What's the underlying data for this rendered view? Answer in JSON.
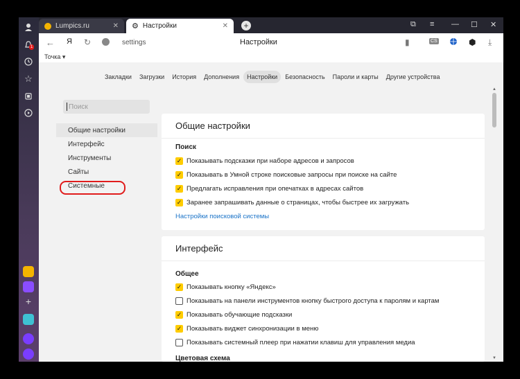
{
  "tabs": [
    {
      "label": "Lumpics.ru"
    },
    {
      "label": "Настройки"
    }
  ],
  "address": {
    "url": "settings",
    "page_title": "Настройки",
    "ya_label": "Я",
    "badge_cs": "CS"
  },
  "bookmarks": {
    "item": "Точка ▾"
  },
  "sidebar_badge": "1",
  "navtabs": [
    "Закладки",
    "Загрузки",
    "История",
    "Дополнения",
    "Настройки",
    "Безопасность",
    "Пароли и карты",
    "Другие устройства"
  ],
  "search": {
    "placeholder": "Поиск"
  },
  "leftnav": [
    "Общие настройки",
    "Интерфейс",
    "Инструменты",
    "Сайты",
    "Системные"
  ],
  "card1": {
    "title": "Общие настройки",
    "section": "Поиск",
    "options": [
      {
        "label": "Показывать подсказки при наборе адресов и запросов",
        "checked": true
      },
      {
        "label": "Показывать в Умной строке поисковые запросы при поиске на сайте",
        "checked": true
      },
      {
        "label": "Предлагать исправления при опечатках в адресах сайтов",
        "checked": true
      },
      {
        "label": "Заранее запрашивать данные о страницах, чтобы быстрее их загружать",
        "checked": true
      }
    ],
    "link": "Настройки поисковой системы"
  },
  "card2": {
    "title": "Интерфейс",
    "section": "Общее",
    "options": [
      {
        "label": "Показывать кнопку «Яндекс»",
        "checked": true
      },
      {
        "label": "Показывать на панели инструментов кнопку быстрого доступа к паролям и картам",
        "checked": false
      },
      {
        "label": "Показывать обучающие подсказки",
        "checked": true
      },
      {
        "label": "Показывать виджет синхронизации в меню",
        "checked": true
      },
      {
        "label": "Показывать системный плеер при нажатии клавиш для управления медиа",
        "checked": false
      }
    ],
    "section2": "Цветовая схема"
  },
  "colors": {
    "accent": "#ffcc00",
    "link": "#1a73c8",
    "highlight": "#e01b1b"
  }
}
